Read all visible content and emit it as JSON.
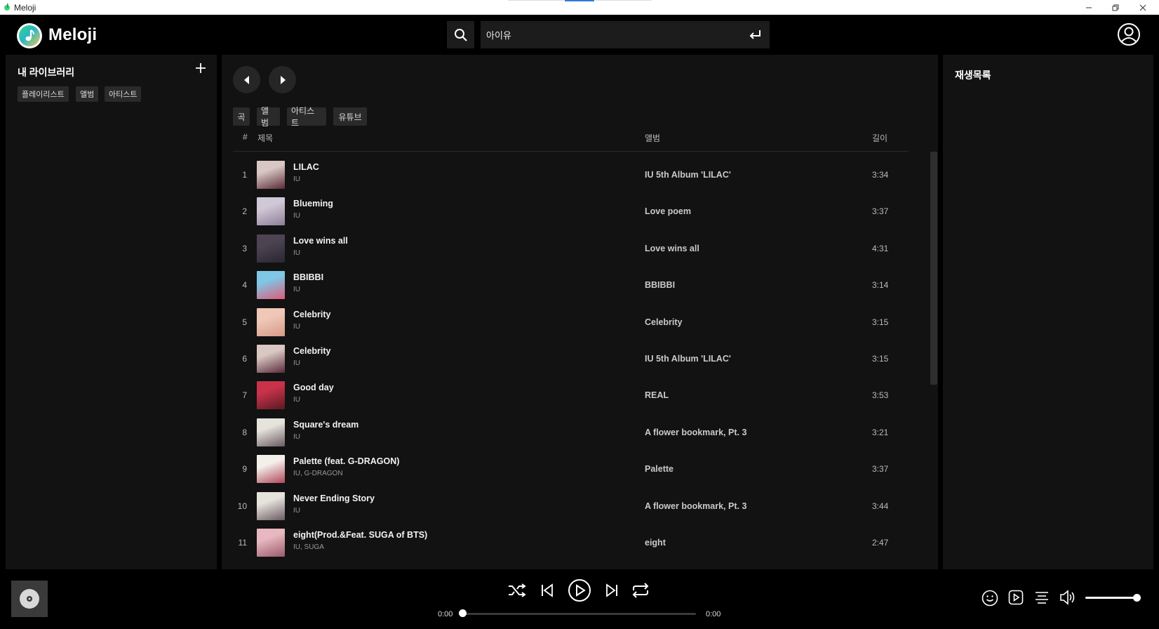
{
  "window": {
    "title": "Meloji"
  },
  "header": {
    "brand": "Meloji",
    "search": {
      "value": "아이유"
    }
  },
  "library": {
    "title": "내 라이브러리",
    "filters": [
      "플레이리스트",
      "앨범",
      "아티스트"
    ]
  },
  "main": {
    "tabs": [
      "곡",
      "앨범",
      "아티스트",
      "유튜브"
    ],
    "columns": {
      "num": "#",
      "title": "제목",
      "album": "앨범",
      "duration": "길이"
    },
    "tracks": [
      {
        "num": "1",
        "title": "LILAC",
        "artist": "IU",
        "album": "IU 5th Album 'LILAC'",
        "duration": "3:34",
        "art": [
          "#d8c7c2",
          "#5a2a3a"
        ]
      },
      {
        "num": "2",
        "title": "Blueming",
        "artist": "IU",
        "album": "Love poem",
        "duration": "3:37",
        "art": [
          "#cfc8d6",
          "#8c7e96"
        ]
      },
      {
        "num": "3",
        "title": "Love wins all",
        "artist": "IU",
        "album": "Love wins all",
        "duration": "4:31",
        "art": [
          "#4c4452",
          "#2a2530"
        ]
      },
      {
        "num": "4",
        "title": "BBIBBI",
        "artist": "IU",
        "album": "BBIBBI",
        "duration": "3:14",
        "art": [
          "#7fc7e6",
          "#e05a78"
        ]
      },
      {
        "num": "5",
        "title": "Celebrity",
        "artist": "IU",
        "album": "Celebrity",
        "duration": "3:15",
        "art": [
          "#f0c8b8",
          "#d69a86"
        ]
      },
      {
        "num": "6",
        "title": "Celebrity",
        "artist": "IU",
        "album": "IU 5th Album 'LILAC'",
        "duration": "3:15",
        "art": [
          "#d8c7c2",
          "#5a2a3a"
        ]
      },
      {
        "num": "7",
        "title": "Good day",
        "artist": "IU",
        "album": "REAL",
        "duration": "3:53",
        "art": [
          "#c8324a",
          "#5a1a22"
        ]
      },
      {
        "num": "8",
        "title": "Square's dream",
        "artist": "IU",
        "album": "A flower bookmark, Pt. 3",
        "duration": "3:21",
        "art": [
          "#e6e2dc",
          "#6a5a62"
        ]
      },
      {
        "num": "9",
        "title": "Palette (feat. G-DRAGON)",
        "artist": "IU, G-DRAGON",
        "album": "Palette",
        "duration": "3:37",
        "art": [
          "#f3f0ea",
          "#b0465a"
        ]
      },
      {
        "num": "10",
        "title": "Never Ending Story",
        "artist": "IU",
        "album": "A flower bookmark, Pt. 3",
        "duration": "3:44",
        "art": [
          "#e6e2dc",
          "#6a5a62"
        ]
      },
      {
        "num": "11",
        "title": "eight(Prod.&Feat. SUGA of BTS)",
        "artist": "IU, SUGA",
        "album": "eight",
        "duration": "2:47",
        "art": [
          "#e8b8c0",
          "#9a5a6a"
        ]
      }
    ]
  },
  "queue": {
    "title": "재생목록"
  },
  "player": {
    "elapsed": "0:00",
    "total": "0:00",
    "progress": 0.0,
    "volume": 1.0
  },
  "colors": {
    "panel": "#121212",
    "background": "#000000",
    "accent": "#2d7bd6"
  }
}
